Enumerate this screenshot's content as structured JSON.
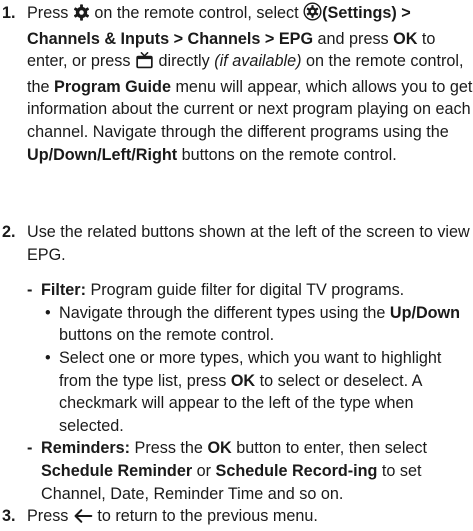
{
  "steps": [
    {
      "num": "1.",
      "t1": "Press ",
      "t2": " on the remote control, select ",
      "settings_label": "(Settings)",
      "path": " > Channels & Inputs > Channels > EPG",
      "t3": " and press ",
      "ok": "OK",
      "t4": " to enter, or press ",
      "t5": " directly ",
      "if_available": "(if available)",
      "t6": " on the remote control, the ",
      "program_guide": "Program Guide",
      "t7": " menu will appear, which allows you to get information about the current or next program playing on each channel. Navigate through the different programs using the ",
      "nav_buttons": "Up/Down/Left/Right",
      "t8": " buttons on the remote control."
    },
    {
      "num": "2.",
      "text": "Use the related buttons shown at the left of the screen to view EPG.",
      "filter": {
        "dash": "-",
        "label": "Filter:",
        "text": " Program guide filter for digital TV programs.",
        "bullets": [
          {
            "dot": "•",
            "a": "Navigate through the different types using the ",
            "b": "Up/Down",
            "c": " buttons on the remote control."
          },
          {
            "dot": "•",
            "a": "Select one or more types, which you want to highlight from the type list, press ",
            "b": "OK",
            "c": " to select or deselect. A checkmark will appear to the left of the type when selected."
          }
        ]
      },
      "reminders": {
        "dash": "-",
        "label": "Reminders:",
        "a": " Press the ",
        "ok": "OK",
        "b": " button to enter, then select ",
        "schedule_reminder": "Schedule Reminder",
        "c": " or ",
        "schedule_recording": "Schedule Record-ing",
        "d": " to set Channel, Date, Reminder Time and so on."
      }
    },
    {
      "num": "3.",
      "t1": "Press ",
      "t2": " to return to the previous menu."
    }
  ],
  "icons": [
    "gear-icon",
    "settings-icon",
    "tv-guide-icon",
    "back-arrow-icon"
  ]
}
